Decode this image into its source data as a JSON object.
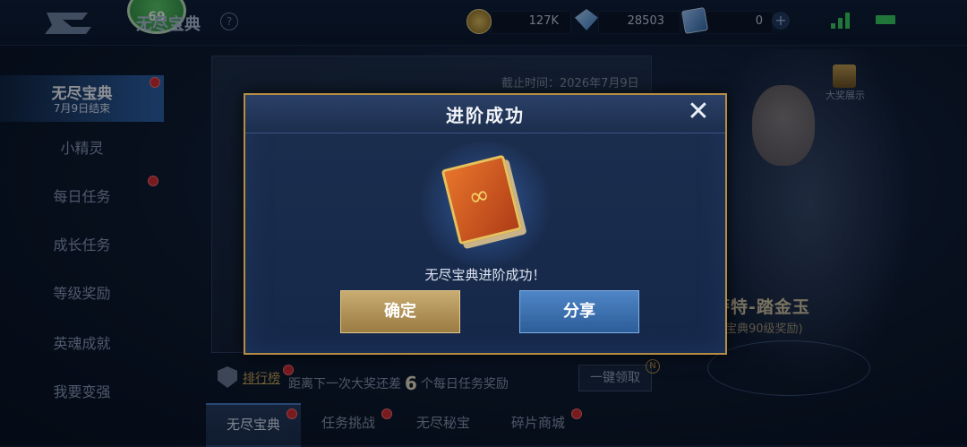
{
  "header": {
    "page_title": "无尽宝典",
    "help": "?",
    "currencies": [
      {
        "icon": "coin-icon",
        "value": "127K"
      },
      {
        "icon": "gem-icon",
        "value": "28503"
      },
      {
        "icon": "ticket-icon",
        "value": "0"
      }
    ],
    "avatar_level": "69"
  },
  "sidebar": {
    "items": [
      {
        "label": "无尽宝典",
        "sub": "7月9日结束",
        "active": true,
        "dot": true
      },
      {
        "label": "小精灵",
        "dot": false
      },
      {
        "label": "每日任务",
        "dot": true
      },
      {
        "label": "成长任务",
        "dot": false
      },
      {
        "label": "等级奖励",
        "dot": false
      },
      {
        "label": "英魂成就",
        "dot": false
      },
      {
        "label": "我要变强",
        "dot": false
      }
    ]
  },
  "main": {
    "deadline": "截止时间：2026年7月9日",
    "award_label": "大奖展示",
    "hero_name": "萨特-踏金玉",
    "hero_sub": "宝典90级奖励)",
    "rank_link": "排行榜",
    "progress_prefix": "距离下一次大奖还差",
    "progress_count": "6",
    "progress_suffix": "个每日任务奖励",
    "claim_all": "一键领取",
    "claim_badge": "N"
  },
  "bottom_tabs": [
    {
      "label": "无尽宝典",
      "active": true
    },
    {
      "label": "任务挑战",
      "active": false
    },
    {
      "label": "无尽秘宝",
      "active": false
    },
    {
      "label": "碎片商城",
      "active": false
    }
  ],
  "dialog": {
    "title": "进阶成功",
    "close": "✕",
    "message": "无尽宝典进阶成功！",
    "confirm": "确定",
    "share": "分享"
  },
  "colors": {
    "accent_gold": "#b68d45",
    "confirm_button": "#b3945a",
    "share_button": "#3d72b0",
    "red_dot": "#d82a2a",
    "signal_green": "#3bd05a"
  }
}
